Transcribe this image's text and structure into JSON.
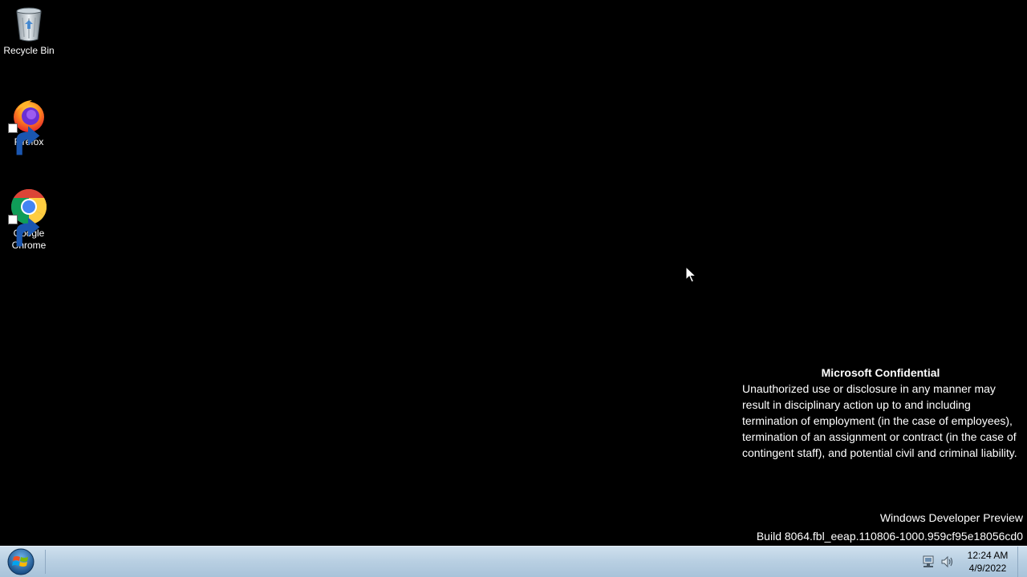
{
  "desktop": {
    "icons": [
      {
        "label": "Recycle Bin",
        "icon": "recycle-bin-icon"
      },
      {
        "label": "Firefox",
        "icon": "firefox-icon"
      },
      {
        "label": "Google Chrome",
        "icon": "chrome-icon"
      }
    ]
  },
  "confidential": {
    "title": "Microsoft Confidential",
    "body": "Unauthorized use or disclosure in any manner may result in disciplinary action up to and including termination of employment (in the case of employees), termination of an assignment or contract (in the case of contingent staff), and potential civil and criminal liability."
  },
  "watermark": {
    "line1": "Windows Developer Preview",
    "line2": "Build 8064.fbl_eeap.110806-1000.959cf95e18056cd0"
  },
  "taskbar": {
    "start_icon": "windows-logo-icon",
    "tray_icons": [
      "network-icon",
      "volume-icon"
    ],
    "clock": {
      "time": "12:24 AM",
      "date": "4/9/2022"
    }
  },
  "colors": {
    "desktop_background": "#000000",
    "taskbar": "#b8cfe2"
  }
}
